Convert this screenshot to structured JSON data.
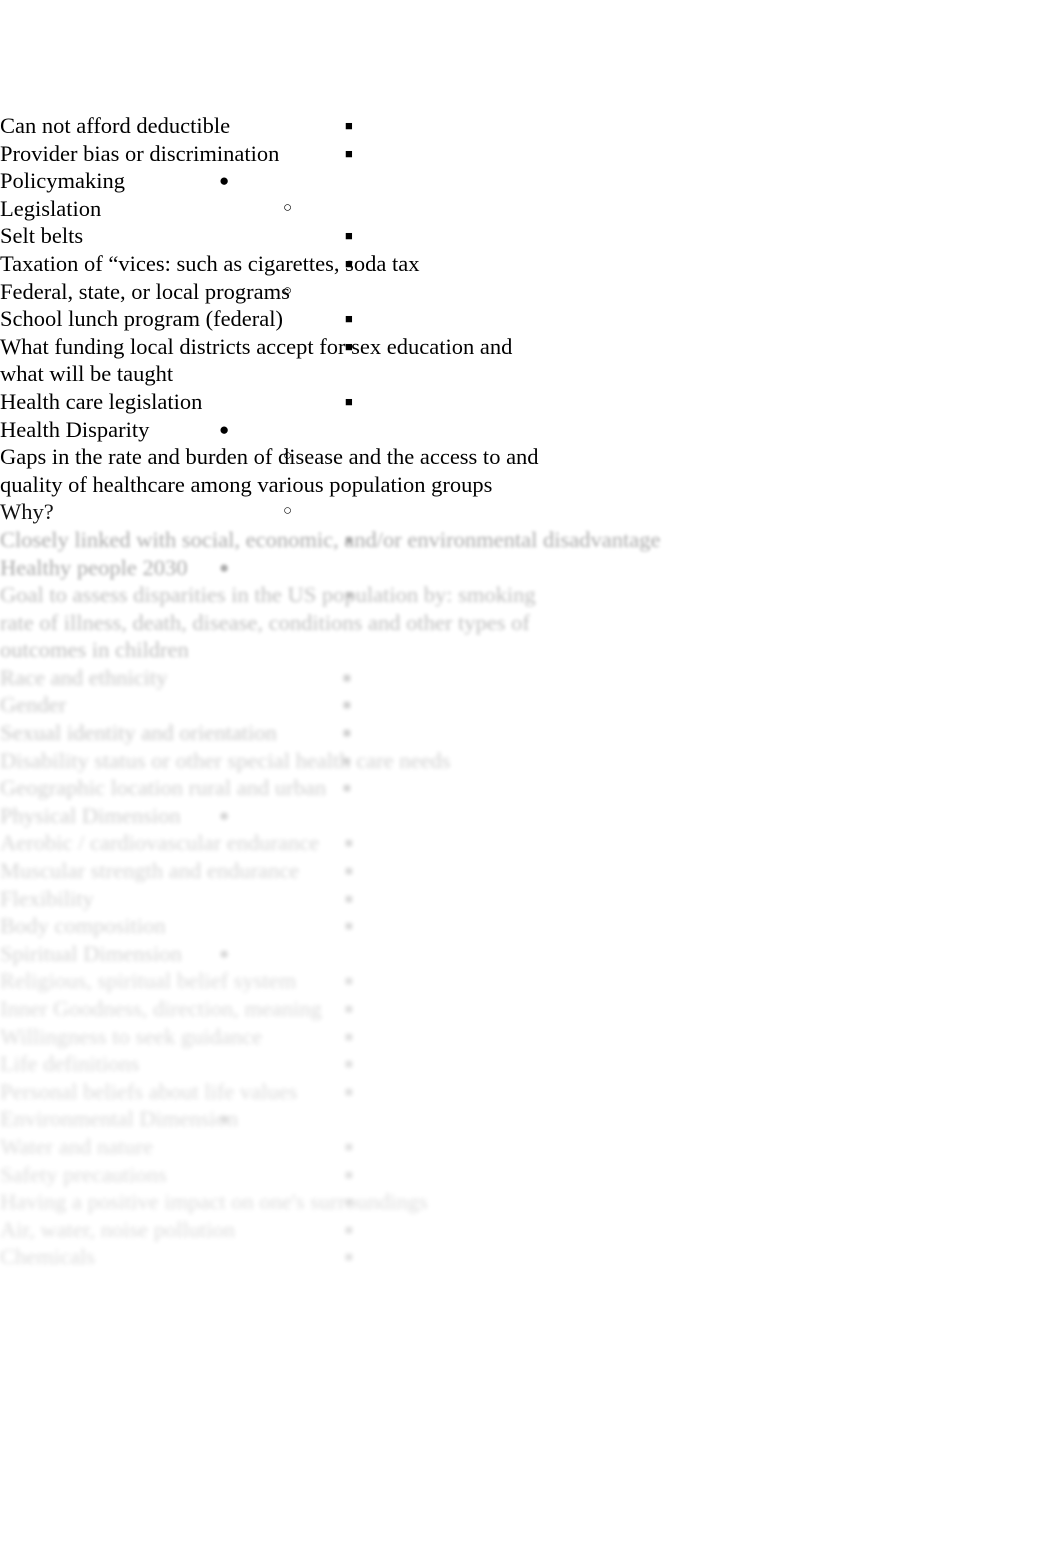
{
  "document": {
    "type": "outline-notes",
    "page_background": "#ffffff",
    "text_color": "#000000",
    "bullet_glyphs": {
      "level1": "●",
      "level2": "○",
      "level3": "■",
      "level4": "■"
    }
  },
  "outline": [
    {
      "level": 3,
      "text": "Can not afford deductible",
      "clarity": "f0"
    },
    {
      "level": 3,
      "text": "Provider bias or discrimination",
      "clarity": "f0"
    },
    {
      "level": 1,
      "text": "Policymaking",
      "clarity": "f0"
    },
    {
      "level": 2,
      "text": "Legislation",
      "clarity": "f0"
    },
    {
      "level": 3,
      "text": "Selt belts",
      "clarity": "f0"
    },
    {
      "level": 3,
      "text": "Taxation of “vices: such as cigarettes, soda tax",
      "clarity": "f0"
    },
    {
      "level": 2,
      "text": "Federal, state, or local programs",
      "clarity": "f0"
    },
    {
      "level": 3,
      "text": "School lunch program (federal)",
      "clarity": "f0"
    },
    {
      "level": 3,
      "text": "What funding local districts accept for sex education and what will be taught",
      "clarity": "f0",
      "wrap": "wide"
    },
    {
      "level": 3,
      "text": "Health care legislation",
      "clarity": "f0"
    },
    {
      "level": 1,
      "text": "Health Disparity",
      "clarity": "f0"
    },
    {
      "level": 2,
      "text": "Gaps in the rate and burden of disease and the access to and quality of healthcare among various population groups",
      "clarity": "f0",
      "wrap": "wide"
    },
    {
      "level": 2,
      "text": "Why?",
      "clarity": "f1"
    },
    {
      "level": 3,
      "text": "Closely linked with social, economic, and/or environmental disadvantage",
      "clarity": "f2"
    },
    {
      "level": 1,
      "text": "Healthy people 2030",
      "clarity": "f2"
    },
    {
      "level": 3,
      "text": "Goal to assess disparities in the US population by: smoking rate of illness, death, disease, conditions and other types of outcomes in children",
      "clarity": "f3",
      "wrap": "wide"
    },
    {
      "level": 4,
      "text": "Race and ethnicity",
      "clarity": "f4"
    },
    {
      "level": 4,
      "text": "Gender",
      "clarity": "f4"
    },
    {
      "level": 4,
      "text": "Sexual identity and orientation",
      "clarity": "f4"
    },
    {
      "level": 4,
      "text": "Disability status or other special health care needs",
      "clarity": "f5"
    },
    {
      "level": 4,
      "text": "Geographic location rural and urban",
      "clarity": "f5"
    },
    {
      "level": 1,
      "text": "Physical Dimension",
      "clarity": "f5"
    },
    {
      "level": 3,
      "text": "Aerobic / cardiovascular endurance",
      "clarity": "f6"
    },
    {
      "level": 3,
      "text": "Muscular strength and endurance",
      "clarity": "f6"
    },
    {
      "level": 3,
      "text": "Flexibility",
      "clarity": "f6"
    },
    {
      "level": 3,
      "text": "Body composition",
      "clarity": "f6"
    },
    {
      "level": 1,
      "text": "Spiritual Dimension",
      "clarity": "f6"
    },
    {
      "level": 3,
      "text": "Religious, spiritual belief system",
      "clarity": "f7"
    },
    {
      "level": 3,
      "text": "Inner Goodness, direction, meaning",
      "clarity": "f7"
    },
    {
      "level": 3,
      "text": "Willingness to seek guidance",
      "clarity": "f7"
    },
    {
      "level": 3,
      "text": "Life definitions",
      "clarity": "f7"
    },
    {
      "level": 3,
      "text": "Personal beliefs about life values",
      "clarity": "f7"
    },
    {
      "level": 1,
      "text": "Environmental Dimension",
      "clarity": "f7"
    },
    {
      "level": 3,
      "text": "Water and nature",
      "clarity": "f8"
    },
    {
      "level": 3,
      "text": "Safety precautions",
      "clarity": "f8"
    },
    {
      "level": 3,
      "text": "Having a positive impact on one's surroundings",
      "clarity": "f8"
    },
    {
      "level": 3,
      "text": "Air, water, noise pollution",
      "clarity": "f8"
    },
    {
      "level": 3,
      "text": "Chemicals",
      "clarity": "f8"
    }
  ]
}
